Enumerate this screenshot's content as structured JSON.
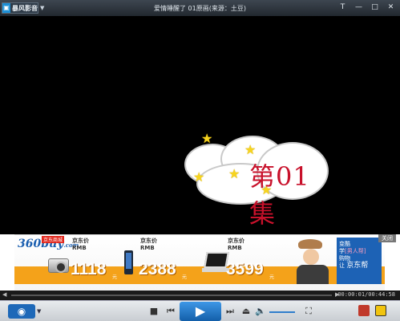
{
  "titlebar": {
    "app_name": "暴风影音",
    "title": "爱情睡醒了 01原画(来源：土豆)",
    "buttons": [
      "T",
      "—",
      "□",
      "✕"
    ]
  },
  "video": {
    "episode_label": "第01集"
  },
  "ad": {
    "logo": "360buy",
    "logo_sub": ".com",
    "badge": "京东商城",
    "items": [
      {
        "label": "京东价",
        "currency": "RMB",
        "price": "1118",
        "unit": "元"
      },
      {
        "label": "京东价",
        "currency": "RMB",
        "price": "2388",
        "unit": "元"
      },
      {
        "label": "京东价",
        "currency": "RMB",
        "price": "3599",
        "unit": "元"
      }
    ],
    "promo": {
      "line1": "变酷",
      "line2": "学",
      "highlight": "[男人帮]",
      "line3": "购物",
      "line4": "让",
      "brand": "京东帮"
    },
    "close_label": "关闭"
  },
  "progress": {
    "fraction": 0.0,
    "time": "00:00:01/00:44:58"
  },
  "colors": {
    "accent": "#1d68b8",
    "price_stripe": "#f4a21a",
    "episode_red": "#c8112b"
  }
}
